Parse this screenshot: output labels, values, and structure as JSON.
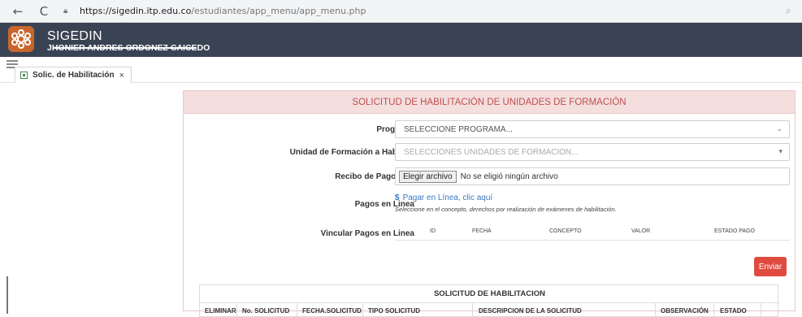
{
  "browser": {
    "back_icon": "←",
    "reload_icon": "C",
    "url_host": "https://sigedin.itp.edu.co",
    "url_path": "/estudiantes/app_menu/app_menu.php"
  },
  "header": {
    "app_title": "SIGEDIN",
    "user_name": "JHONIER ANDRES ORDONEZ CAICEDO",
    "bg_color": "#3a4354",
    "logo_color": "#c8662d"
  },
  "tabs": [
    {
      "label": "Solic. de Habilitación",
      "close": "×"
    }
  ],
  "form": {
    "title": "SOLICITUD DE HABILITACIÓN DE UNIDADES DE FORMACIÓN",
    "programa_label": "Programa",
    "programa_value": "SELECCIONE PROGRAMA...",
    "unidad_label": "Unidad de Formación a Habilitar",
    "unidad_placeholder": "SELECCIONES UNIDADES DE FORMACION...",
    "recibo_label": "Recibo de Pago PDF",
    "file_button": "Elegir archivo",
    "file_status": "No se eligió ningún archivo",
    "pagos_label": "Pagos en Linea",
    "pay_link": "Pagar en Línea, clic aquí",
    "pay_note": "Seleccione en el concepto, derechos por realización de exámenes de habilitación.",
    "vincular_label": "Vincular Pagos en Linea",
    "vincular_columns": [
      "ID",
      "FECHA",
      "CONCEPTO",
      "VALOR",
      "ESTADO PAGO"
    ],
    "send_button": "Enviar",
    "accent_color": "#e04b40"
  },
  "request_table": {
    "title": "SOLICITUD DE HABILITACION",
    "columns": [
      "ELIMINAR",
      "No. SOLICITUD",
      "FECHA.SOLICITUD",
      "TIPO SOLICITUD",
      "DESCRIPCION DE LA SOLICITUD",
      "OBSERVACIÓN",
      "ESTADO"
    ]
  }
}
